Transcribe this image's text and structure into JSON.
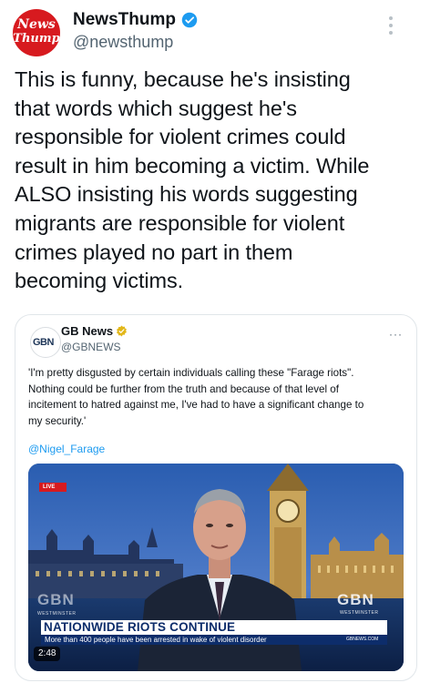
{
  "author": {
    "avatar_text_line1": "News",
    "avatar_text_line2": "Thump",
    "display_name": "NewsThump",
    "handle": "@newsthump",
    "verified": true
  },
  "tweet": {
    "text": "This is funny, because he's insisting\nthat words which suggest he's\nresponsible for violent crimes could\nresult in him becoming a victim. While\nALSO insisting his words suggesting\nmigrants are responsible for violent\ncrimes played no part in them\nbecoming victims."
  },
  "quoted_tweet": {
    "avatar_text": "GBN",
    "display_name": "GB News",
    "handle": "@GBNEWS",
    "more_label": "···",
    "text": "'I'm pretty disgusted by certain individuals calling these \"Farage riots\".\nNothing could be further from the truth and because of that level of\nincitement to hatred against me, I've had to have a significant change to\nmy security.'",
    "mention": "@Nigel_Farage",
    "media": {
      "live_label": "LIVE",
      "channel_logo": "GBN",
      "channel_sub": "WESTMINSTER",
      "headline": "NATIONWIDE RIOTS CONTINUE",
      "ticker": "More than 400 people have been arrested in wake of violent disorder",
      "ticker_url": "GBNEWS.COM",
      "duration": "2:48"
    }
  },
  "colors": {
    "brand_red": "#d71a1f",
    "verified_blue": "#1d9bf0",
    "gold_badge": "#e2b719",
    "gb_navy": "#0d2d6b"
  },
  "icons": {
    "verified": "verified-badge-icon",
    "more": "more-vertical-icon",
    "gold_check": "gold-verified-badge-icon"
  }
}
